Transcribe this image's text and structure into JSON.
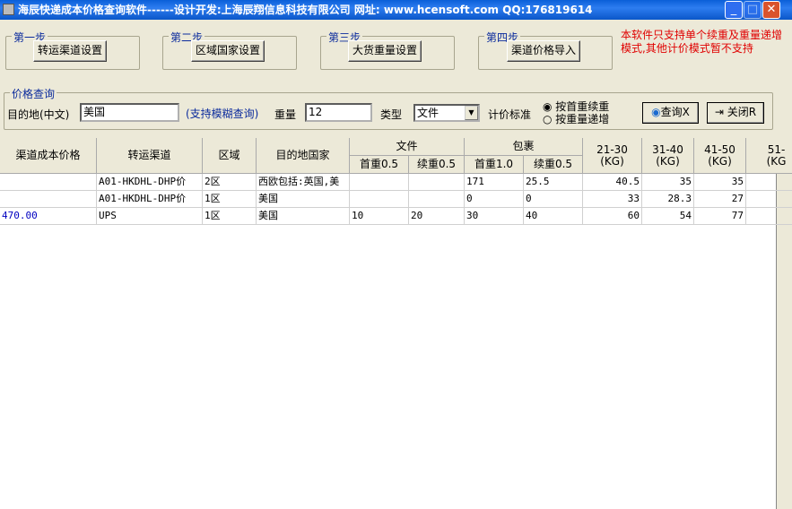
{
  "window": {
    "title": "海辰快递成本价格查询软件------设计开发:上海辰翔信息科技有限公司 网址: www.hcensoft.com QQ:176819614"
  },
  "steps": [
    {
      "label": "第一步",
      "button": "转运渠道设置"
    },
    {
      "label": "第二步",
      "button": "区域国家设置"
    },
    {
      "label": "第三步",
      "button": "大货重量设置"
    },
    {
      "label": "第四步",
      "button": "渠道价格导入"
    }
  ],
  "note": "本软件只支持单个续重及重量递增模式,其他计价模式暂不支持",
  "query": {
    "group": "价格查询",
    "dest_label": "目的地(中文)",
    "dest_value": "美国",
    "fuzzy_hint": "(支持模糊查询)",
    "weight_label": "重量",
    "weight_value": "12",
    "type_label": "类型",
    "type_value": "文件",
    "pricing_label": "计价标准",
    "radio1": "按首重续重",
    "radio2": "按重量递增",
    "radio_selected": "按首重续重",
    "search_btn": "查询X",
    "close_btn": "关闭R"
  },
  "table": {
    "headers": [
      "渠道成本价格",
      "转运渠道",
      "区域",
      "目的地国家"
    ],
    "doc_group": "文件",
    "parcel_group": "包裹",
    "sub_headers": [
      "首重0.5",
      "续重0.5",
      "首重1.0",
      "续重0.5"
    ],
    "range_headers": [
      "21-30\n(KG)",
      "31-40\n(KG)",
      "41-50\n(KG)",
      "51-\n(KG"
    ],
    "rows": [
      [
        "",
        "A01-HKDHL-DHP价",
        "2区",
        "西欧包括:英国,美",
        "",
        "",
        "171",
        "25.5",
        "40.5",
        "35",
        "35",
        ""
      ],
      [
        "",
        "A01-HKDHL-DHP价",
        "1区",
        "美国",
        "",
        "",
        "0",
        "0",
        "33",
        "28.3",
        "27",
        ":"
      ],
      [
        "470.00",
        "UPS",
        "1区",
        "美国",
        "10",
        "20",
        "30",
        "40",
        "60",
        "54",
        "77",
        ""
      ]
    ]
  },
  "colors": {
    "cost_text": "#0000c0",
    "note": "#e00000",
    "label": "#0a2a9c"
  }
}
